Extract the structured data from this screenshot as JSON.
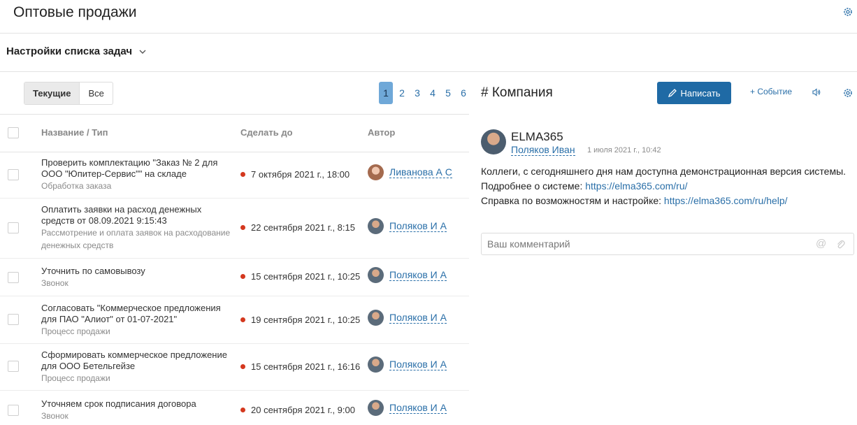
{
  "header": {
    "title": "Оптовые продажи"
  },
  "subheader": {
    "title": "Настройки списка задач"
  },
  "tabs": [
    {
      "label": "Текущие"
    },
    {
      "label": "Все"
    }
  ],
  "pagination": {
    "pages": [
      "1",
      "2",
      "3",
      "4",
      "5",
      "6"
    ],
    "current": "1"
  },
  "table": {
    "columns": {
      "name": "Название / Тип",
      "due": "Сделать до",
      "author": "Автор"
    },
    "rows": [
      {
        "name": "Проверить комплектацию \"Заказ № 2 для ООО \"Юпитер-Сервис\"\" на складе",
        "type": "Обработка заказа",
        "due": "7 октября 2021 г., 18:00",
        "author": "Ливанова А С"
      },
      {
        "name": "Оплатить заявки на расход денежных средств от 08.09.2021 9:15:43",
        "type": "Рассмотрение и оплата заявок на расходование денежных средств",
        "due": "22 сентября 2021 г., 8:15",
        "author": "Поляков И А"
      },
      {
        "name": "Уточнить по самовывозу",
        "type": "Звонок",
        "due": "15 сентября 2021 г., 10:25",
        "author": "Поляков И А"
      },
      {
        "name": "Согласовать \"Коммерческое предложения для ПАО \"Алиот\" от 01-07-2021\"",
        "type": "Процесс продажи",
        "due": "19 сентября 2021 г., 10:25",
        "author": "Поляков И А"
      },
      {
        "name": "Сформировать коммерческое предложение для ООО Бетельгейзе",
        "type": "Процесс продажи",
        "due": "15 сентября 2021 г., 16:16",
        "author": "Поляков И А"
      },
      {
        "name": "Уточняем срок подписания договора",
        "type": "Звонок",
        "due": "20 сентября 2021 г., 9:00",
        "author": "Поляков И А"
      }
    ]
  },
  "feed": {
    "title": "# Компания",
    "write_label": "Написать",
    "event_label": "+ Событие",
    "post": {
      "author": "ELMA365",
      "user": "Поляков Иван",
      "date": "1 июля 2021 г., 10:42",
      "line1": "Коллеги, с сегодняшнего дня нам доступна демонстрационная версия системы.",
      "line2_text": "Подробнее о системе: ",
      "line2_link": "https://elma365.com/ru/",
      "line3_text": "Справка по возможностям и настройке: ",
      "line3_link": "https://elma365.com/ru/help/"
    },
    "comment_placeholder": "Ваш комментарий"
  },
  "colors": {
    "accent": "#1f6aa5",
    "link": "#2a6fa8",
    "due_dot": "#d4381e",
    "page_active": "#6fa8d8"
  }
}
